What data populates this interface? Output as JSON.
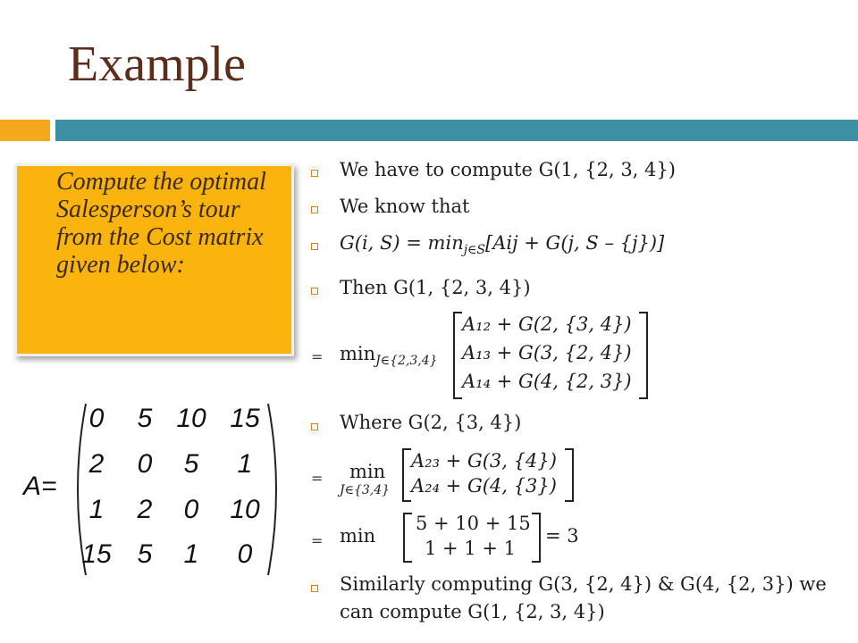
{
  "slide": {
    "title": "Example",
    "callout": "Compute the optimal Salesperson’s tour from the Cost matrix given below:",
    "matrix": {
      "label": "A=",
      "rows": [
        [
          "0",
          "5",
          "10",
          "15"
        ],
        [
          "2",
          "0",
          "5",
          "1"
        ],
        [
          "1",
          "2",
          "0",
          "10"
        ],
        [
          "15",
          "5",
          "1",
          "0"
        ]
      ]
    },
    "points": {
      "p1": "We have to compute G(1, {2, 3, 4})",
      "p2": "We know that",
      "p3": "G(i, S)  =  min",
      "p3_sub": "j∈S",
      "p3_rest": "[Aij  +  G(j, S – {j})]",
      "p4": "Then G(1, {2, 3, 4})",
      "eq": "=",
      "min": "min",
      "min1_sub": "J∈{2,3,4}",
      "m1_r1": "A₁₂ + G(2, {3, 4})",
      "m1_r2": "A₁₃ + G(3, {2, 4})",
      "m1_r3": "A₁₄ + G(4, {2, 3})",
      "p5": "Where G(2, {3, 4})",
      "min2_sub": "J∈{3,4}",
      "m2_r1": "A₂₃ + G(3, {4})",
      "m2_r2": "A₂₄ + G(4, {3})",
      "m3_r1": "5 + 10 + 15",
      "m3_r2": "1 + 1 + 1",
      "m3_result": "= 3",
      "p6_l1": "Similarly computing G(3, {2, 4}) & G(4, {2, 3}) we",
      "p6_l2": "can compute G(1, {2, 3, 4})"
    }
  }
}
